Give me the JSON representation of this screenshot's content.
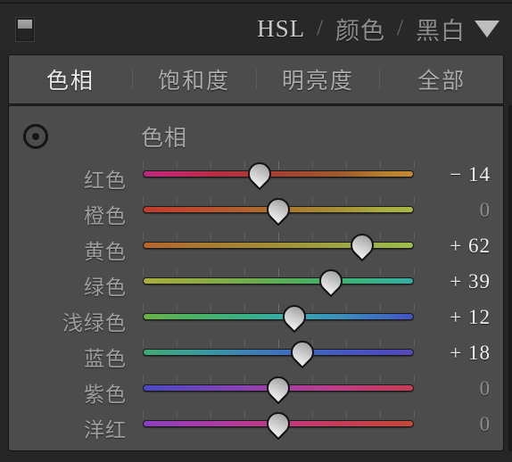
{
  "header": {
    "toggle_icon": "panel-toggle-icon",
    "modes": [
      {
        "label": "HSL",
        "active": true
      },
      {
        "label": "颜色",
        "active": false
      },
      {
        "label": "黑白",
        "active": false
      }
    ],
    "separator": "/",
    "disclosure_icon": "chevron-down-icon"
  },
  "tabs": [
    {
      "label": "色相",
      "active": true
    },
    {
      "label": "饱和度",
      "active": false
    },
    {
      "label": "明亮度",
      "active": false
    },
    {
      "label": "全部",
      "active": false
    }
  ],
  "section": {
    "target_tool_icon": "target-adjustment-icon",
    "title": "色相"
  },
  "colors": {
    "panel_bg": "#4c4c4c",
    "header_bg": "#282828",
    "outline": "#151515",
    "label_text": "#9e9e9e",
    "value_text": "#efefef",
    "value_zero_text": "#8e8e8e",
    "handle_fill": "#d3d3d3"
  },
  "slider_range": {
    "min": -100,
    "max": 100,
    "default": 0
  },
  "sliders": [
    {
      "name": "red",
      "label": "红色",
      "value": -14,
      "value_text": "− 14",
      "gradient": "linear-gradient(to right, #b82a7e 0%, #c2296b 10%, #b52e45 26%, #a93a33 42%, #a2492f 58%, #a35b2c 74%, #b8812f 90%, #c08a33 100%)"
    },
    {
      "name": "orange",
      "label": "橙色",
      "value": 0,
      "value_text": "0",
      "gradient": "linear-gradient(to right, #c23a30 0%, #bc4b2d 18%, #b0622d 38%, #a87b2f 56%, #a69235 74%, #a6ac3f 88%, #a8b844 100%)"
    },
    {
      "name": "yellow",
      "label": "黄色",
      "value": 62,
      "value_text": "+ 62",
      "gradient": "linear-gradient(to right, #b7642c 0%, #ad7330 16%, #a48334 34%, #9f9439 54%, #9ca540 72%, #9db347 88%, #9dbe4d 100%)"
    },
    {
      "name": "green",
      "label": "绿色",
      "value": 39,
      "value_text": "+ 39",
      "gradient": "linear-gradient(to right, #a9ac3c 0%, #93ac40 18%, #72ac4c 38%, #4faf5e 58%, #3cb076 76%, #36ae92 92%, #37aba3 100%)"
    },
    {
      "name": "aqua",
      "label": "浅绿色",
      "value": 12,
      "value_text": "+ 12",
      "gradient": "linear-gradient(to right, #6cb148 0%, #4eb25f 16%, #3bb183 36%, #37acaa 54%, #3b93bb 70%, #3f74c0 86%, #4353c4 100%)"
    },
    {
      "name": "blue",
      "label": "蓝色",
      "value": 18,
      "value_text": "+ 18",
      "gradient": "linear-gradient(to right, #3fa873 0%, #3a9e98 18%, #3c85b3 36%, #3f6cbd 56%, #4558c1 74%, #4d4bbf 90%, #5647b8 100%)"
    },
    {
      "name": "purple",
      "label": "紫色",
      "value": 0,
      "value_text": "0",
      "gradient": "linear-gradient(to right, #4a49c0 0%, #6446bd 16%, #8442b5 34%, #a63fa3 52%, #bd3d8a 70%, #c43d6d 86%, #c23e52 100%)"
    },
    {
      "name": "magenta",
      "label": "洋红",
      "value": 0,
      "value_text": "0",
      "gradient": "linear-gradient(to right, #8a3fbe 0%, #a13cae 18%, #b73a95 36%, #c23a79 54%, #c33c5c 72%, #c24444 88%, #c14a38 100%)"
    }
  ]
}
